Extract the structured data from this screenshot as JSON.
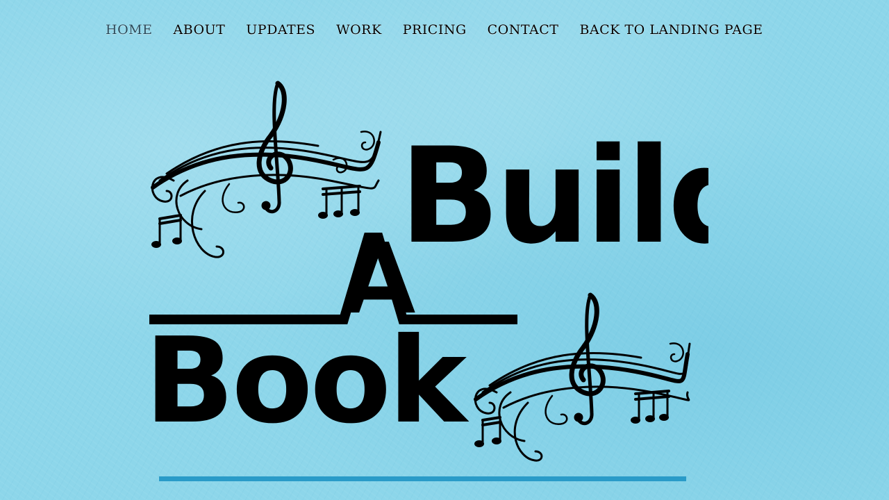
{
  "nav": {
    "items": [
      {
        "label": "HOME",
        "active": true
      },
      {
        "label": "ABOUT",
        "active": false
      },
      {
        "label": "UPDATES",
        "active": false
      },
      {
        "label": "WORK",
        "active": false
      },
      {
        "label": "PRICING",
        "active": false
      },
      {
        "label": "CONTACT",
        "active": false
      },
      {
        "label": "BACK TO LANDING PAGE",
        "active": false
      }
    ]
  },
  "logo": {
    "word1": "Build",
    "word2": "A",
    "word3": "Book",
    "icons": [
      "music-notes-swirl-icon",
      "music-notes-swirl-icon"
    ]
  },
  "colors": {
    "background": "#8dd6ea",
    "text": "#000000",
    "active_nav": "#2a4a5a",
    "divider": "#2a9bc8"
  }
}
